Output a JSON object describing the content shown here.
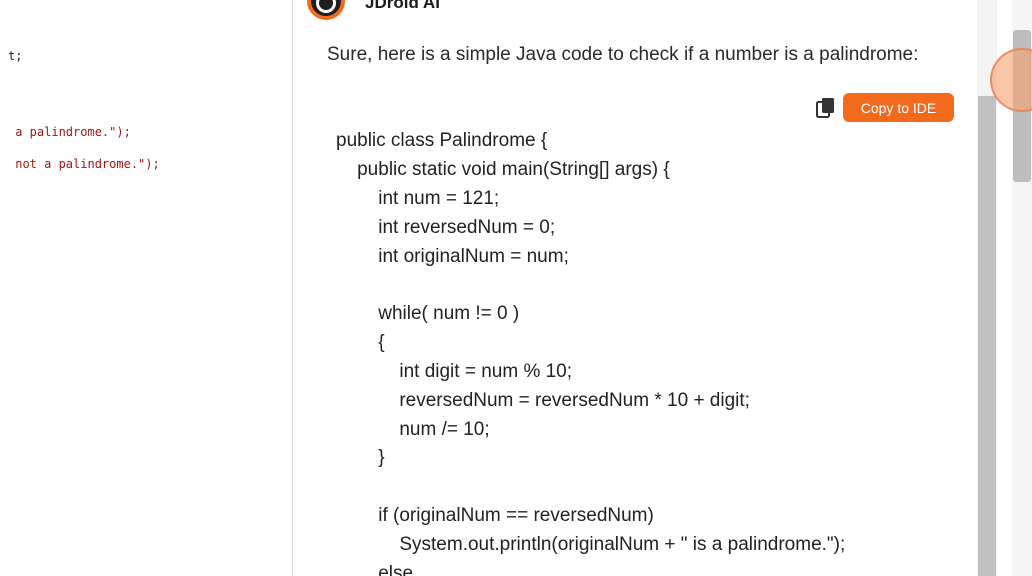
{
  "editor": {
    "lines": [
      {
        "code": "t;",
        "str": ""
      },
      {
        "code": "",
        "str": " a palindrome.\");"
      },
      {
        "code": "",
        "str": " not a palindrome.\");"
      }
    ]
  },
  "chat": {
    "bot_name": "JDroid AI",
    "intro": "Sure, here is a simple Java code to check if a number is a palindrome:",
    "copy_icon": "copy-icon",
    "copy_to_ide_label": "Copy to IDE",
    "code_lines": [
      "public class Palindrome {",
      "    public static void main(String[] args) {",
      "        int num = 121;",
      "        int reversedNum = 0;",
      "        int originalNum = num;",
      "",
      "        while( num != 0 )",
      "        {",
      "            int digit = num % 10;",
      "            reversedNum = reversedNum * 10 + digit;",
      "            num /= 10;",
      "        }",
      "",
      "        if (originalNum == reversedNum)",
      "            System.out.println(originalNum + \" is a palindrome.\");",
      "        else"
    ]
  },
  "colors": {
    "accent": "#f26b1d",
    "string_literal": "#a31515"
  }
}
